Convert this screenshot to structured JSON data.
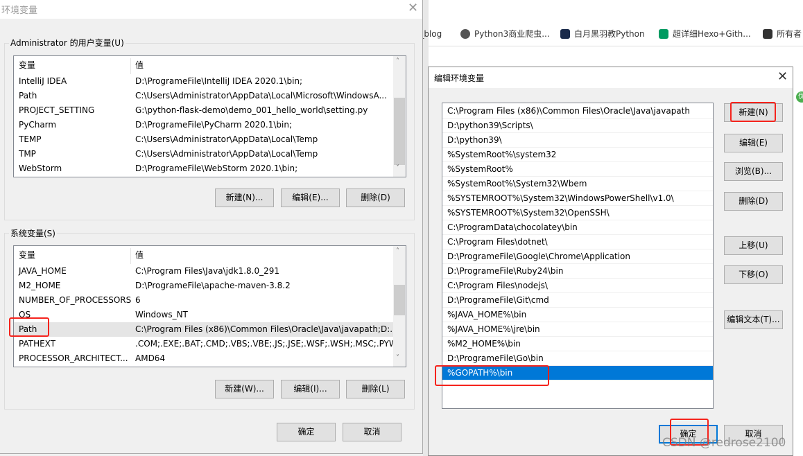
{
  "browser": {
    "bookmarks": [
      {
        "label": "o_blog",
        "icon": "none"
      },
      {
        "label": "Python3商业爬虫...",
        "icon": "globe-icon",
        "color": "#555555"
      },
      {
        "label": "白月黑羽教Python",
        "icon": "moon-logo-icon",
        "color": "#1a2a4a"
      },
      {
        "label": "超详细Hexo+Gith...",
        "icon": "sf-logo-icon",
        "color": "#009a61"
      },
      {
        "label": "所有者",
        "icon": "robot-logo-icon",
        "color": "#333333"
      }
    ],
    "badge": "优"
  },
  "env_dialog": {
    "title": "环境变量",
    "user_group": {
      "label": "Administrator 的用户变量(U)",
      "columns": [
        "变量",
        "值"
      ],
      "rows": [
        [
          "IntelliJ IDEA",
          "D:\\ProgrameFile\\IntelliJ IDEA 2020.1\\bin;"
        ],
        [
          "Path",
          "C:\\Users\\Administrator\\AppData\\Local\\Microsoft\\WindowsA..."
        ],
        [
          "PROJECT_SETTING",
          "G:\\python-flask-demo\\demo_001_hello_world\\setting.py"
        ],
        [
          "PyCharm",
          "D:\\ProgrameFile\\PyCharm 2020.1\\bin;"
        ],
        [
          "TEMP",
          "C:\\Users\\Administrator\\AppData\\Local\\Temp"
        ],
        [
          "TMP",
          "C:\\Users\\Administrator\\AppData\\Local\\Temp"
        ],
        [
          "WebStorm",
          "D:\\ProgrameFile\\WebStorm 2020.1\\bin;"
        ]
      ],
      "buttons": [
        "新建(N)...",
        "编辑(E)...",
        "删除(D)"
      ]
    },
    "system_group": {
      "label": "系统变量(S)",
      "columns": [
        "变量",
        "值"
      ],
      "rows": [
        [
          "JAVA_HOME",
          "C:\\Program Files\\Java\\jdk1.8.0_291"
        ],
        [
          "M2_HOME",
          "D:\\ProgrameFile\\apache-maven-3.8.2"
        ],
        [
          "NUMBER_OF_PROCESSORS",
          "6"
        ],
        [
          "OS",
          "Windows_NT"
        ],
        [
          "Path",
          "C:\\Program Files (x86)\\Common Files\\Oracle\\Java\\javapath;D:..."
        ],
        [
          "PATHEXT",
          ".COM;.EXE;.BAT;.CMD;.VBS;.VBE;.JS;.JSE;.WSF;.WSH;.MSC;.PYW..."
        ],
        [
          "PROCESSOR_ARCHITECT...",
          "AMD64"
        ]
      ],
      "selected_index": 4,
      "buttons": [
        "新建(W)...",
        "编辑(I)...",
        "删除(L)"
      ]
    },
    "ok": "确定",
    "cancel": "取消"
  },
  "edit_dialog": {
    "title": "编辑环境变量",
    "items": [
      "C:\\Program Files (x86)\\Common Files\\Oracle\\Java\\javapath",
      "D:\\python39\\Scripts\\",
      "D:\\python39\\",
      "%SystemRoot%\\system32",
      "%SystemRoot%",
      "%SystemRoot%\\System32\\Wbem",
      "%SYSTEMROOT%\\System32\\WindowsPowerShell\\v1.0\\",
      "%SYSTEMROOT%\\System32\\OpenSSH\\",
      "C:\\ProgramData\\chocolatey\\bin",
      "C:\\Program Files\\dotnet\\",
      "D:\\ProgrameFile\\Google\\Chrome\\Application",
      "D:\\ProgrameFile\\Ruby24\\bin",
      "C:\\Program Files\\nodejs\\",
      "D:\\ProgrameFile\\Git\\cmd",
      "%JAVA_HOME%\\bin",
      "%JAVA_HOME%\\jre\\bin",
      "%M2_HOME%\\bin",
      "D:\\ProgrameFile\\Go\\bin",
      "%GOPATH%\\bin"
    ],
    "selected_index": 18,
    "selection_color": "#0078d7",
    "buttons": [
      "新建(N)",
      "编辑(E)",
      "浏览(B)...",
      "删除(D)",
      "上移(U)",
      "下移(O)",
      "编辑文本(T)..."
    ],
    "ok": "确定",
    "cancel": "取消"
  },
  "annotation_color": "#f5231c",
  "watermark": "CSDN @redrose2100"
}
